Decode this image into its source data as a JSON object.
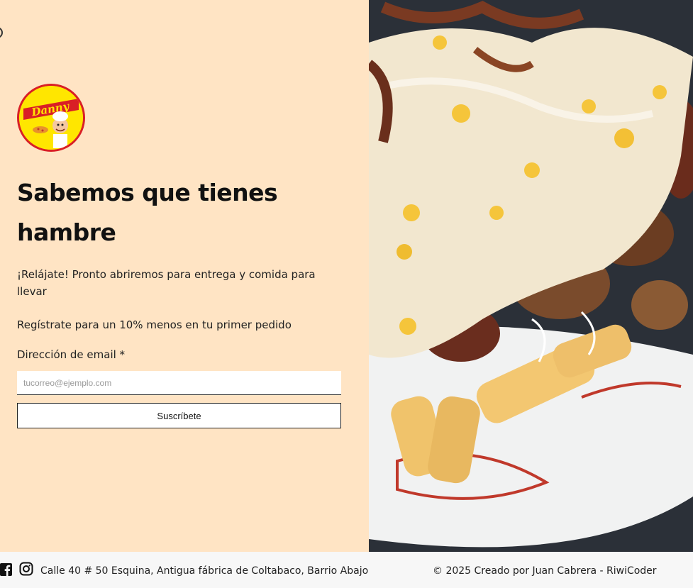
{
  "hero": {
    "headline": "Sabemos que tienes hambre",
    "intro": "¡Relájate! Pronto abriremos para entrega y comida para llevar",
    "promo": "Regístrate para un 10% menos en tu primer pedido"
  },
  "logo": {
    "brand_text": "Danny"
  },
  "form": {
    "email_label": "Dirección de email *",
    "email_placeholder": "tucorreo@ejemplo.com",
    "email_value": "",
    "subscribe_label": "Suscríbete"
  },
  "footer": {
    "facebook_icon": "facebook-icon",
    "instagram_icon": "instagram-icon",
    "address": "Calle 40 # 50 Esquina, Antigua fábrica de Coltabaco, Barrio Abajo",
    "copyright": "© 2025 Creado por Juan Cabrera - RiwiCoder"
  },
  "colors": {
    "panel_background": "#ffe4c4",
    "logo_yellow": "#ffe600",
    "logo_red": "#d91f26",
    "footer_background": "#f7f7f7"
  }
}
